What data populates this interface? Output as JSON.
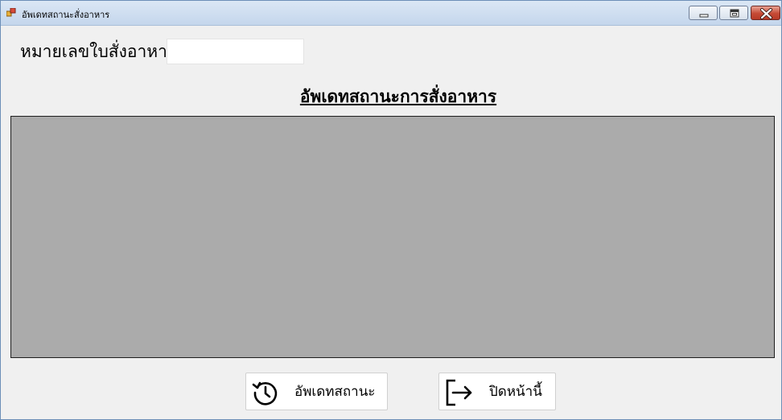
{
  "window": {
    "title": "อัพเดทสถานะสั่งอาหาร",
    "controls": {
      "minimize_icon": "minimize-icon",
      "maximize_icon": "restore-icon",
      "close_icon": "close-icon"
    }
  },
  "form": {
    "order_number_label": "หมายเลขใบสั่งอาหาร",
    "order_number_value": "",
    "heading": "อัพเดทสถานะการสั่งอาหาร"
  },
  "buttons": {
    "update_status_label": "อัพเดทสถานะ",
    "update_status_icon": "history-clock-icon",
    "close_page_label": "ปิดหน้านี้",
    "close_page_icon": "exit-arrow-icon"
  },
  "colors": {
    "grid_background": "#ababab",
    "window_background": "#f0f0f0",
    "close_button": "#c54a35"
  }
}
